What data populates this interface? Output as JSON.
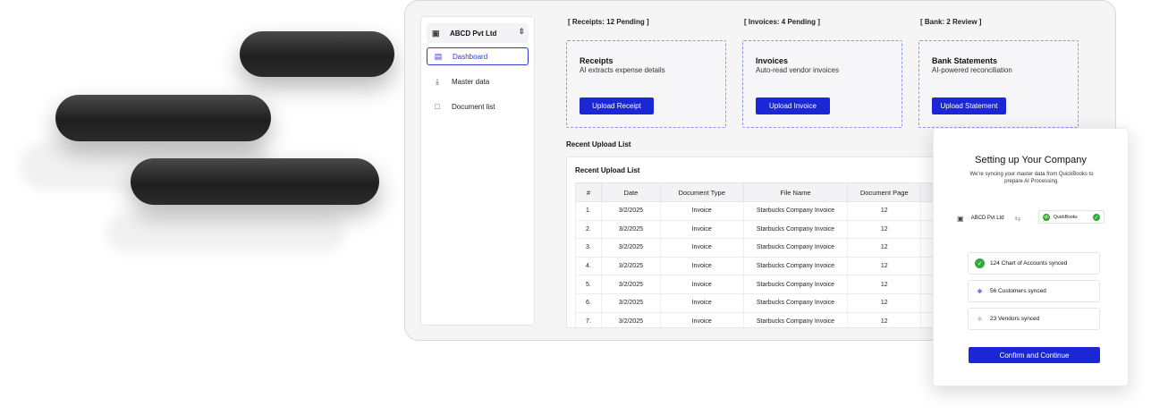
{
  "sidebar": {
    "company_name": "ABCD Pvt Ltd",
    "items": [
      {
        "label": "Dashboard",
        "icon": "inbox-icon",
        "active": true
      },
      {
        "label": "Master data",
        "icon": "download-icon",
        "active": false
      },
      {
        "label": "Document list",
        "icon": "document-icon",
        "active": false
      }
    ]
  },
  "stats": {
    "receipts": "[ Receipts: 12 Pending ]",
    "invoices": "[ Invoices: 4 Pending ]",
    "bank": "[ Bank: 2 Review ]"
  },
  "cards": [
    {
      "title": "Receipts",
      "subtitle": "AI extracts expense details",
      "button": "Upload Receipt"
    },
    {
      "title": "Invoices",
      "subtitle": "Auto-read vendor invoices",
      "button": "Upload Invoice"
    },
    {
      "title": "Bank Statements",
      "subtitle": "AI-powered reconciliation",
      "button": "Upload Statement"
    }
  ],
  "recent": {
    "section_title": "Recent Upload List",
    "table_title": "Recent Upload List",
    "columns": [
      "#",
      "Date",
      "Document Type",
      "File Name",
      "Document Page"
    ],
    "rows": [
      [
        "1.",
        "3/2/2025",
        "Invoice",
        "Starbucks Company Invoice",
        "12"
      ],
      [
        "2.",
        "3/2/2025",
        "Invoice",
        "Starbucks Company Invoice",
        "12"
      ],
      [
        "3.",
        "3/2/2025",
        "Invoice",
        "Starbucks Company Invoice",
        "12"
      ],
      [
        "4.",
        "3/2/2025",
        "Invoice",
        "Starbucks Company Invoice",
        "12"
      ],
      [
        "5.",
        "3/2/2025",
        "Invoice",
        "Starbucks Company Invoice",
        "12"
      ],
      [
        "6.",
        "3/2/2025",
        "Invoice",
        "Starbucks Company Invoice",
        "12"
      ],
      [
        "7.",
        "3/2/2025",
        "Invoice",
        "Starbucks Company Invoice",
        "12"
      ]
    ]
  },
  "setup": {
    "title": "Setting up Your Company",
    "subtitle": "We're syncing your master data from QuickBooks to prepare AI Processing.",
    "company": "ABCD Pvt Ltd",
    "integration": "QuickBooks",
    "statuses": [
      {
        "label": "124 Chart of Accounts synced",
        "state": "done"
      },
      {
        "label": "56 Customers synced",
        "state": "in-progress"
      },
      {
        "label": "23 Vendors synced",
        "state": "pending"
      }
    ],
    "confirm_button": "Confirm and Continue"
  },
  "colors": {
    "accent": "#1b27d4",
    "success": "#2eaa3c",
    "pill": "#2b2b2b"
  }
}
